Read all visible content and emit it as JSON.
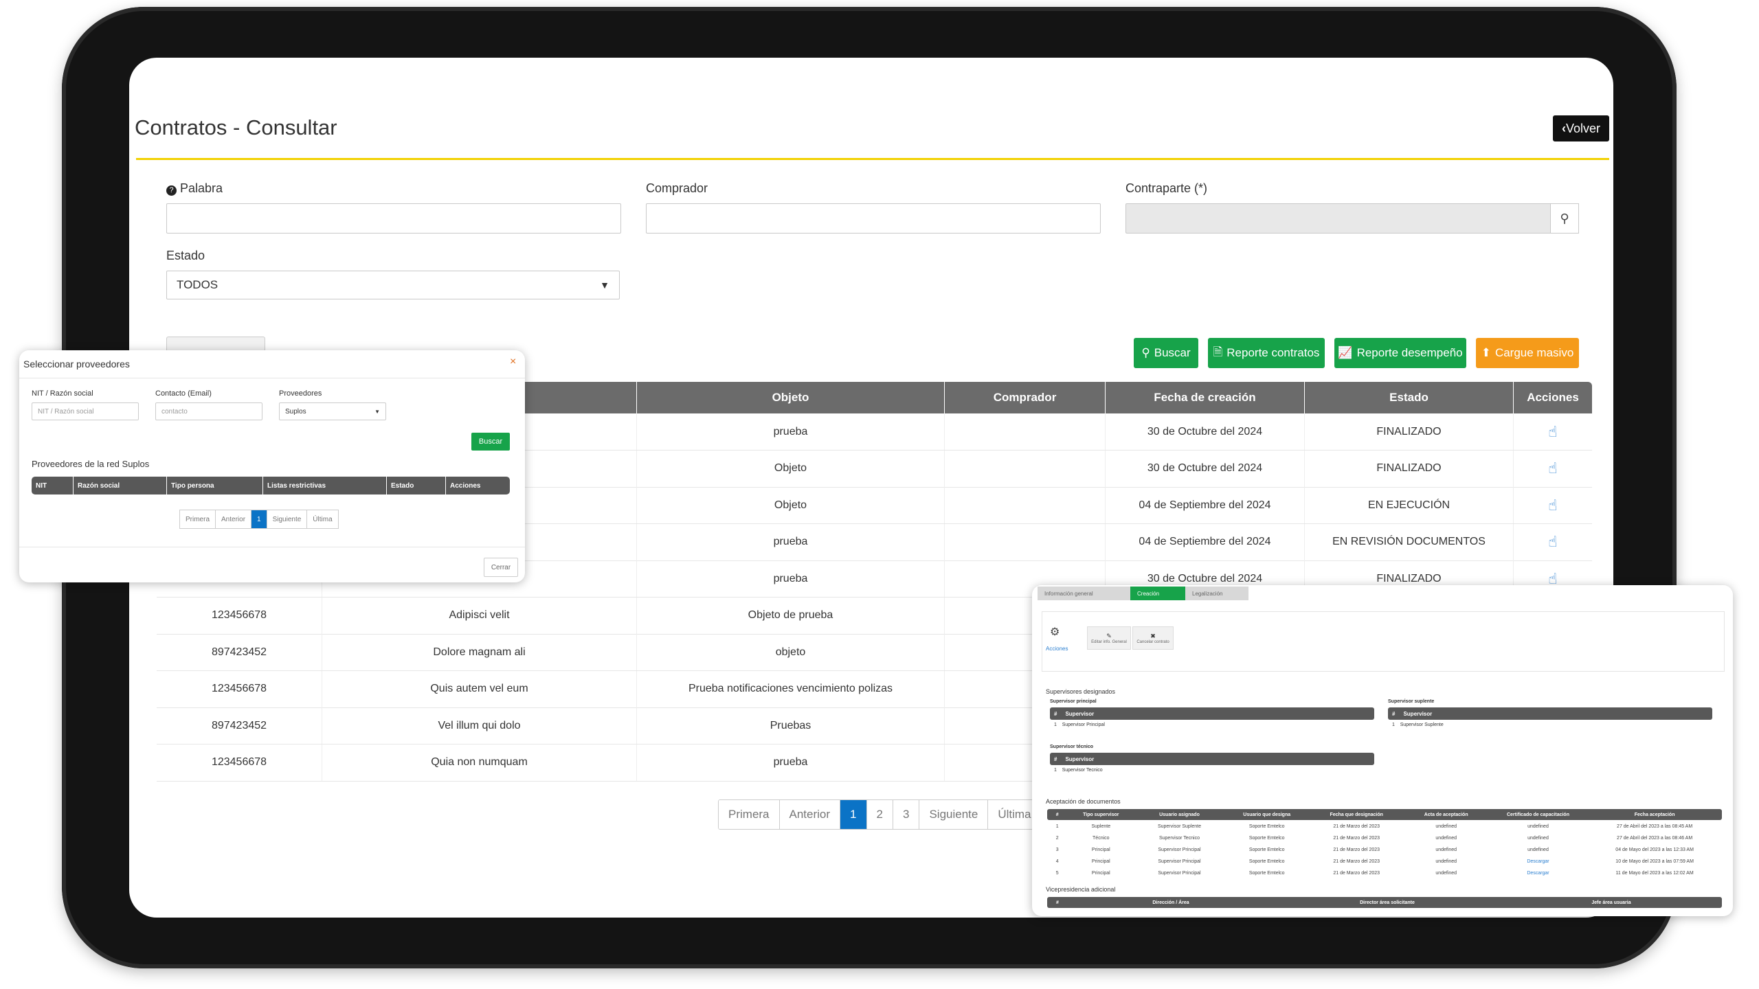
{
  "page": {
    "title": "Contratos - Consultar",
    "back_label": "Volver"
  },
  "filters": {
    "palabra_label": "Palabra",
    "comprador_label": "Comprador",
    "contraparte_label": "Contraparte (*)",
    "estado_label": "Estado",
    "estado_value": "TODOS"
  },
  "actions": {
    "buscar": "Buscar",
    "reporte_contratos": "Reporte contratos",
    "reporte_desempeno": "Reporte desempeño",
    "cargue_masivo": "Cargue masivo"
  },
  "colors": {
    "accent_yellow": "#f2d100",
    "green": "#17a34a",
    "orange": "#f59b1a",
    "blue": "#0b73c6"
  },
  "table": {
    "headers": [
      "Objeto",
      "Comprador",
      "Fecha de creación",
      "Estado",
      "Acciones"
    ],
    "rows": [
      {
        "nit": "",
        "razon": "",
        "objeto": "prueba",
        "comprador": "",
        "fecha": "30 de Octubre del 2024",
        "estado": "FINALIZADO"
      },
      {
        "nit": "",
        "razon": "",
        "objeto": "Objeto",
        "comprador": "",
        "fecha": "30 de Octubre del 2024",
        "estado": "FINALIZADO"
      },
      {
        "nit": "",
        "razon": "",
        "objeto": "Objeto",
        "comprador": "",
        "fecha": "04 de Septiembre del 2024",
        "estado": "EN EJECUCIÓN"
      },
      {
        "nit": "",
        "razon": "",
        "objeto": "prueba",
        "comprador": "",
        "fecha": "04 de Septiembre del 2024",
        "estado": "EN REVISIÓN DOCUMENTOS"
      },
      {
        "nit": "",
        "razon": "",
        "objeto": "prueba",
        "comprador": "",
        "fecha": "30 de Octubre del 2024",
        "estado": "FINALIZADO"
      },
      {
        "nit": "123456678",
        "razon": "Adipisci velit",
        "objeto": "Objeto de prueba",
        "comprador": "",
        "fecha": "",
        "estado": ""
      },
      {
        "nit": "897423452",
        "razon": "Dolore magnam ali",
        "objeto": "objeto",
        "comprador": "",
        "fecha": "",
        "estado": ""
      },
      {
        "nit": "123456678",
        "razon": "Quis autem vel eum",
        "objeto": "Prueba notificaciones vencimiento polizas",
        "comprador": "",
        "fecha": "",
        "estado": ""
      },
      {
        "nit": "897423452",
        "razon": "Vel illum qui dolo",
        "objeto": "Pruebas",
        "comprador": "",
        "fecha": "",
        "estado": ""
      },
      {
        "nit": "123456678",
        "razon": "Quia non numquam",
        "objeto": "prueba",
        "comprador": "",
        "fecha": "",
        "estado": ""
      }
    ]
  },
  "pagination": [
    "Primera",
    "Anterior",
    "1",
    "2",
    "3",
    "Siguiente",
    "Última"
  ],
  "popup_proveedores": {
    "title": "Seleccionar proveedores",
    "close_symbol": "×",
    "nit_label": "NIT / Razón social",
    "nit_placeholder": "NIT / Razón social",
    "contacto_label": "Contacto (Email)",
    "contacto_placeholder": "contacto",
    "proveedores_label": "Proveedores",
    "proveedores_value": "Suplos",
    "buscar": "Buscar",
    "section_title": "Proveedores de la red Suplos",
    "headers": [
      "NIT",
      "Razón social",
      "Tipo persona",
      "Listas restrictivas",
      "Estado",
      "Acciones"
    ],
    "pagination": [
      "Primera",
      "Anterior",
      "1",
      "Siguiente",
      "Última"
    ],
    "cerrar": "Cerrar"
  },
  "popup_detalle": {
    "tabs": [
      "Información general",
      "Creación",
      "Legalización"
    ],
    "acciones_label": "Acciones",
    "editar_label": "Editar info. General",
    "cancelar_label": "Cancelar contrato",
    "supervisores_title": "Supervisores designados",
    "principal_label": "Supervisor principal",
    "suplente_label": "Supervisor suplente",
    "tecnico_label": "Supervisor técnico",
    "hash": "#",
    "supervisor_col": "Supervisor",
    "principal_row": "Supervisor Principal",
    "suplente_row": "Supervisor Suplente",
    "tecnico_row": "Supervisor Tecnico",
    "aceptacion_title": "Aceptación de documentos",
    "acept_headers": [
      "#",
      "Tipo supervisor",
      "Usuario asignado",
      "Usuario que designa",
      "Fecha que designación",
      "Acta de aceptación",
      "Certificado de capacitación",
      "Fecha aceptación"
    ],
    "acept_rows": [
      [
        "1",
        "Suplente",
        "Supervisor Suplente",
        "Soporte Emtelco",
        "21 de Marzo del 2023",
        "undefined",
        "undefined",
        "27 de Abril del 2023 a las 08:45 AM"
      ],
      [
        "2",
        "Técnico",
        "Supervisor Tecnico",
        "Soporte Emtelco",
        "21 de Marzo del 2023",
        "undefined",
        "undefined",
        "27 de Abril del 2023 a las 08:46 AM"
      ],
      [
        "3",
        "Principal",
        "Supervisor Principal",
        "Soporte Emtelco",
        "21 de Marzo del 2023",
        "undefined",
        "undefined",
        "04 de Mayo del 2023 a las 12:33 AM"
      ],
      [
        "4",
        "Principal",
        "Supervisor Principal",
        "Soporte Emtelco",
        "21 de Marzo del 2023",
        "undefined",
        "Descargar",
        "10 de Mayo del 2023 a las 07:59 AM"
      ],
      [
        "5",
        "Principal",
        "Supervisor Principal",
        "Soporte Emtelco",
        "21 de Marzo del 2023",
        "undefined",
        "Descargar",
        "11 de Mayo del 2023 a las 12:02 AM"
      ]
    ],
    "vicepresidencia_title": "Vicepresidencia adicional",
    "vice_headers": [
      "#",
      "Dirección / Área",
      "Director área solicitante",
      "Jefe área usuaria"
    ]
  }
}
